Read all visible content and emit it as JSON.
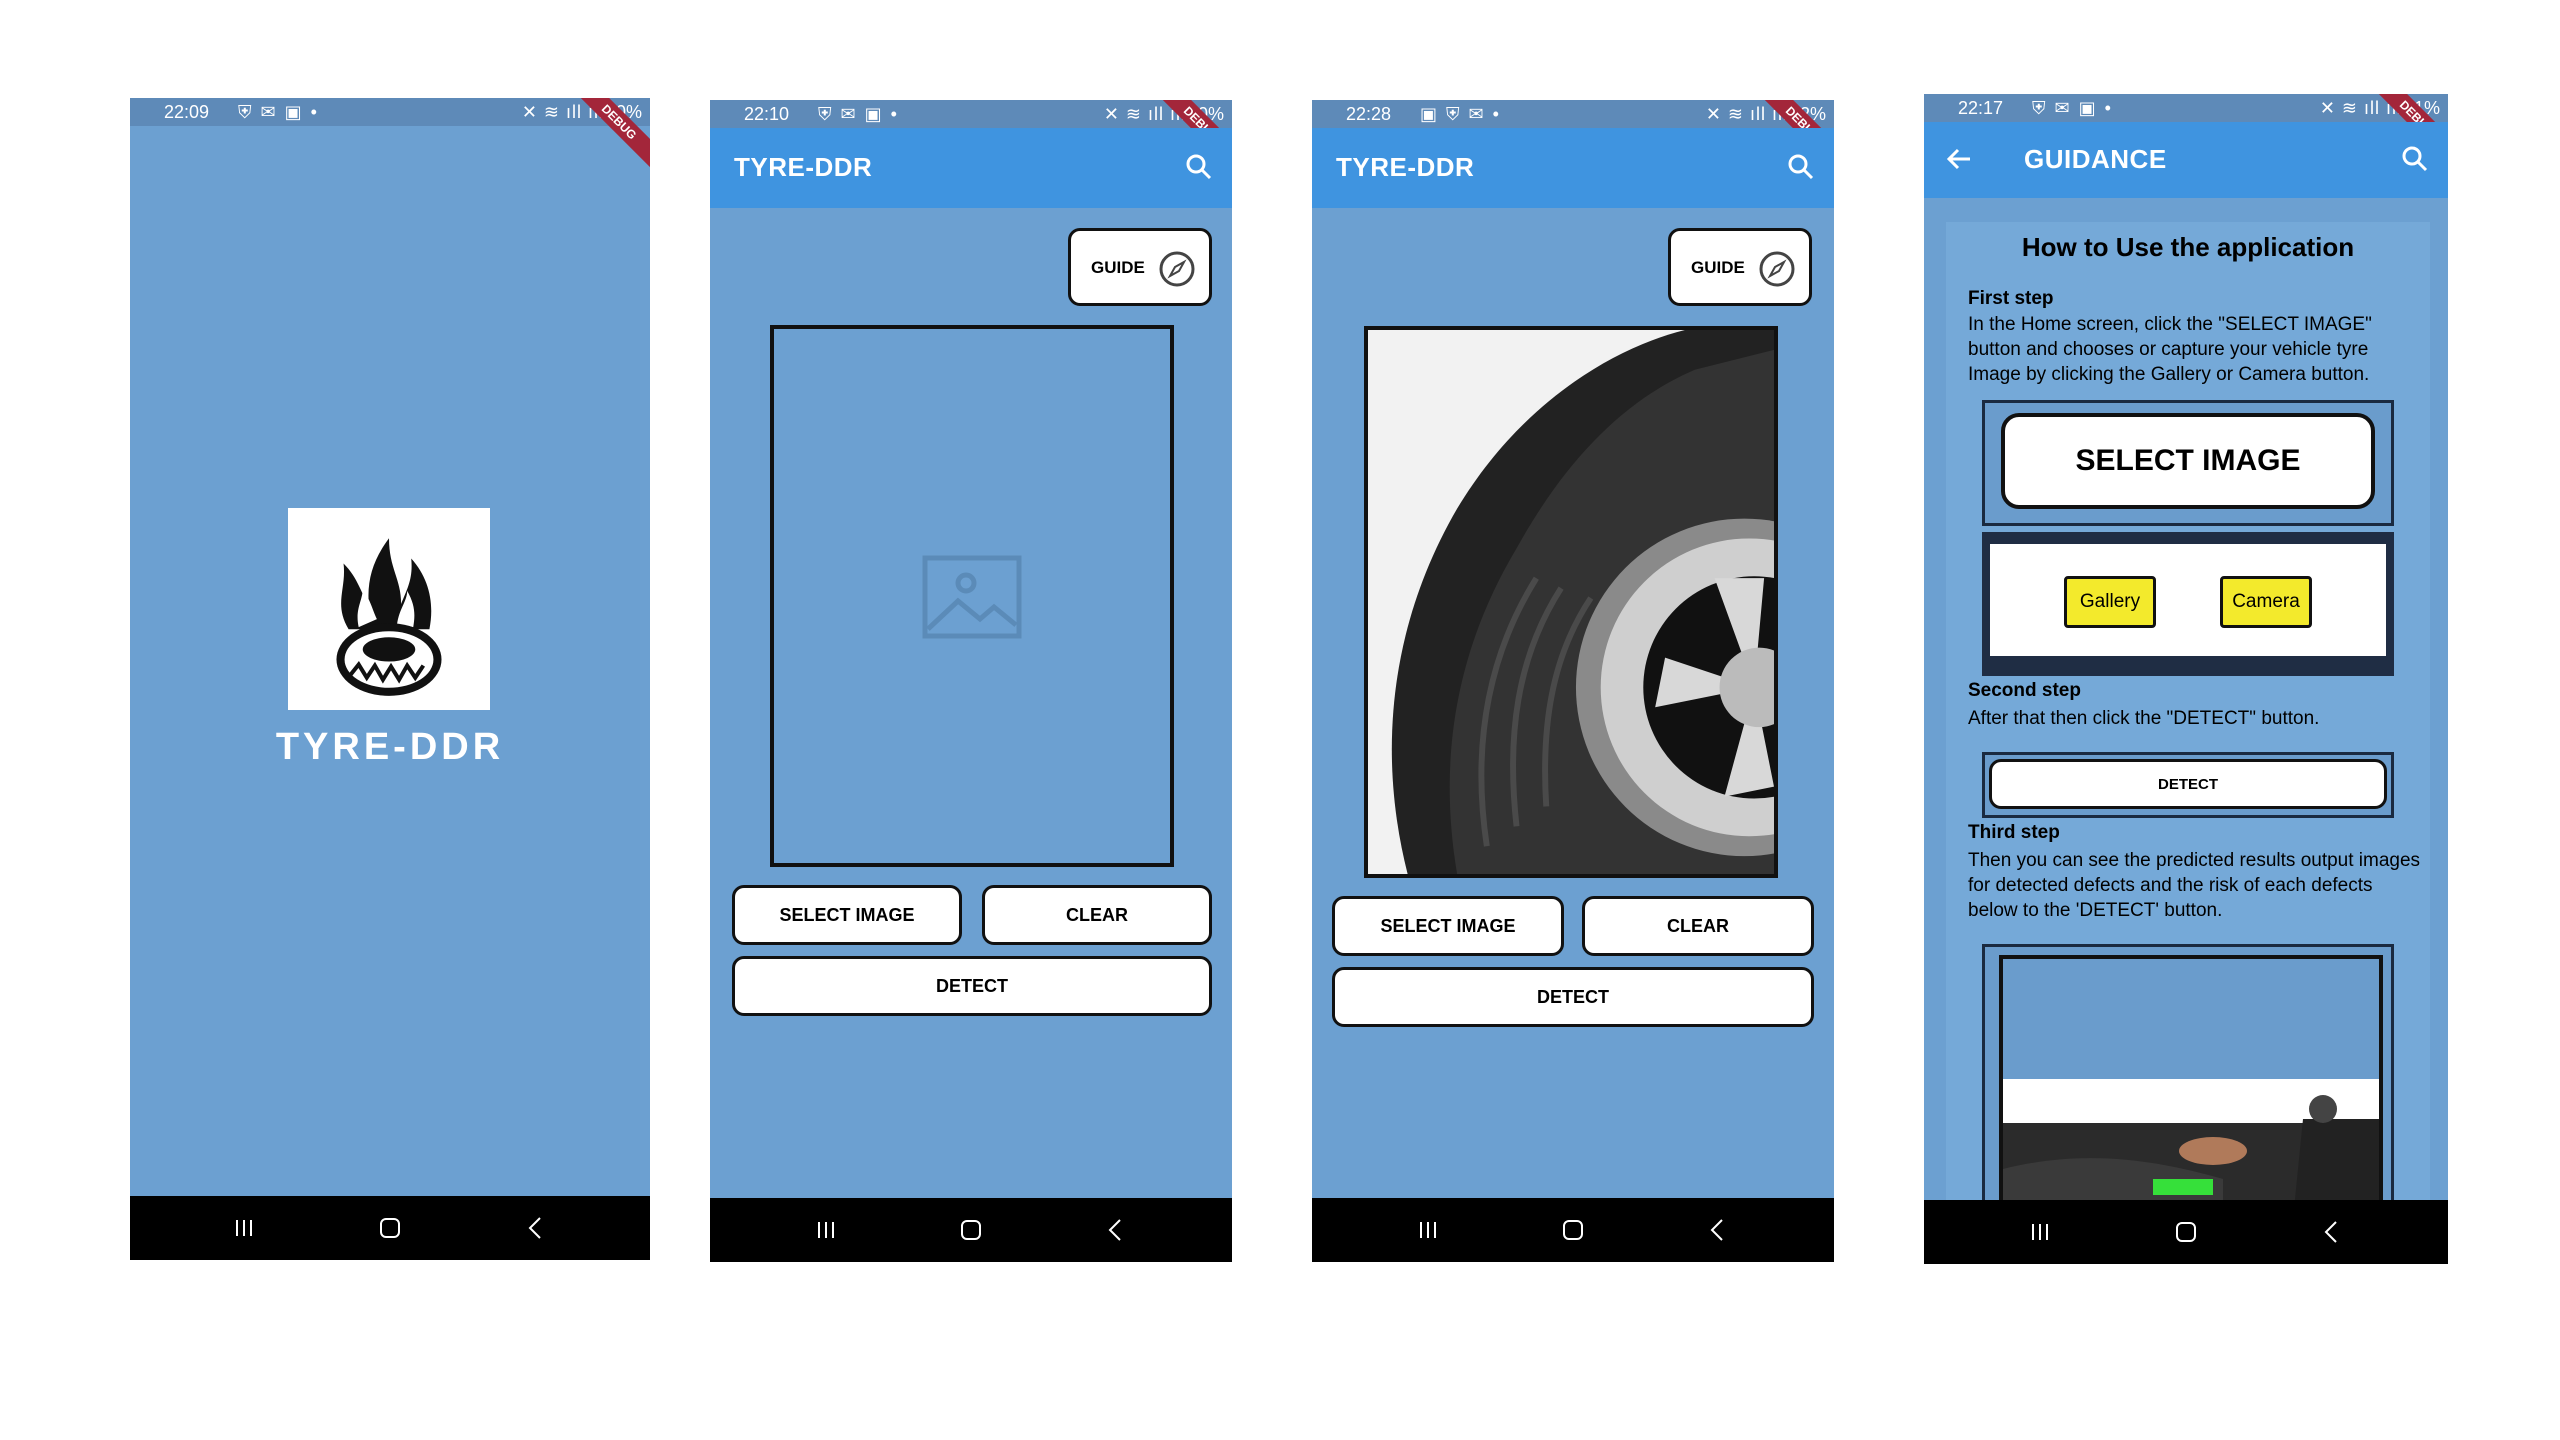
{
  "screens": {
    "splash": {
      "time": "22:09",
      "battery": "50%",
      "brand": "TYRE-DDR",
      "debug": "DEBUG"
    },
    "home_empty": {
      "time": "22:10",
      "battery": "50%",
      "debug": "DEBUG",
      "title": "TYRE-DDR",
      "guide_label": "GUIDE",
      "select_label": "SELECT IMAGE",
      "clear_label": "CLEAR",
      "detect_label": "DETECT"
    },
    "home_image": {
      "time": "22:28",
      "battery": "52%",
      "debug": "DEBUG",
      "title": "TYRE-DDR",
      "guide_label": "GUIDE",
      "select_label": "SELECT IMAGE",
      "clear_label": "CLEAR",
      "detect_label": "DETECT"
    },
    "guidance": {
      "time": "22:17",
      "battery": "51%",
      "debug": "DEBUG",
      "title": "GUIDANCE",
      "heading": "How to Use the application",
      "step1_title": "First step",
      "step1_text": "In the Home screen, click the \"SELECT IMAGE\" button and chooses or capture your vehicle tyre Image by clicking the Gallery or Camera button.",
      "select_label": "SELECT IMAGE",
      "gallery_label": "Gallery",
      "camera_label": "Camera",
      "step2_title": "Second step",
      "step2_text": "After that then click the \"DETECT\" button.",
      "detect_label": "DETECT",
      "step3_title": "Third step",
      "step3_text": "Then you can see the predicted results output images for detected defects and the risk of each defects below to the 'DETECT' button."
    }
  },
  "colors": {
    "background": "#6ca0d1",
    "appbar": "#3f94e0",
    "status": "#5e8ab8",
    "debug_ribbon": "#a3263a",
    "button_yellow": "#f3ea2c"
  }
}
